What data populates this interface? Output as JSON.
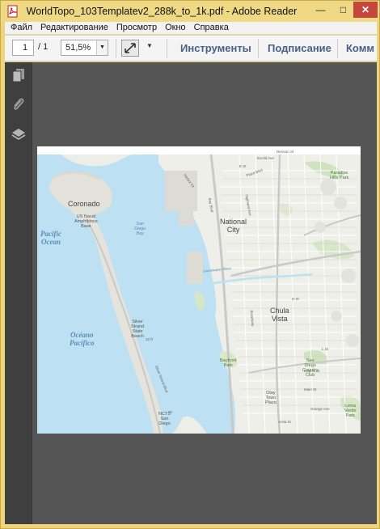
{
  "window": {
    "title": "WorldTopo_103Templatev2_288k_to_1k.pdf - Adobe Reader",
    "minimize_glyph": "—",
    "maximize_glyph": "□",
    "close_glyph": "✕"
  },
  "menu": {
    "items": [
      {
        "label": "Файл"
      },
      {
        "label": "Редактирование"
      },
      {
        "label": "Просмотр"
      },
      {
        "label": "Окно"
      },
      {
        "label": "Справка"
      }
    ]
  },
  "toolbar": {
    "page_current": "1",
    "page_total": "/ 1",
    "zoom": "51,5%",
    "tools_label": "Инструменты",
    "sign_label": "Подписание",
    "comment_label": "Комм"
  },
  "icons": {
    "app": "pdf-icon",
    "nav_pages": "pages-icon",
    "nav_attachments": "paperclip-icon",
    "nav_layers": "layers-icon",
    "fit": "expand-arrows-icon"
  },
  "colors": {
    "titlebar": "#efd985",
    "link": "#4a5f86",
    "canvas": "#555555",
    "water": "#bde0f2",
    "land": "#efefea"
  },
  "map": {
    "ocean_en": "Pacific\nOcean",
    "ocean_es": "Océano\nPacífico",
    "city_coronado": "Coronado",
    "city_national": "National\nCity",
    "city_chula": "Chula\nVista",
    "bay": "San\nDiego\nBay",
    "base_amphib": "US Naval\nAmphibious\nBase",
    "park_silver": "Silver\nStrand\nState\nBeach",
    "park_bayfront": "Bayfront\nPark",
    "club": "San\nDiego\nCountry\nClub",
    "plaza": "Otay\nTown\nPlaza",
    "ncts": "NCTS\nSan\nDiego",
    "paradise": "Paradise\nHills Park",
    "lv_park": "Loma\nVerde\nPark",
    "road_75": "75",
    "road_22": "22 ft",
    "road_strand": "Silver Strand Blvd",
    "road_bay": "Bay Blvd",
    "road_anita": "Anita St",
    "road_main": "Main St",
    "road_orange": "Orange Ave",
    "road_h": "H St",
    "road_e": "E St",
    "road_l": "L St",
    "road_naples": "Naples St",
    "road_broadway": "Broadway",
    "road_harbor": "Harbor Dr",
    "road_highland": "Highland Ave",
    "road_plaza": "Plaza Blvd",
    "road_euclid": "Euclid Ave",
    "road_division": "Division St",
    "road_sweetwater": "Sweetwater River"
  }
}
